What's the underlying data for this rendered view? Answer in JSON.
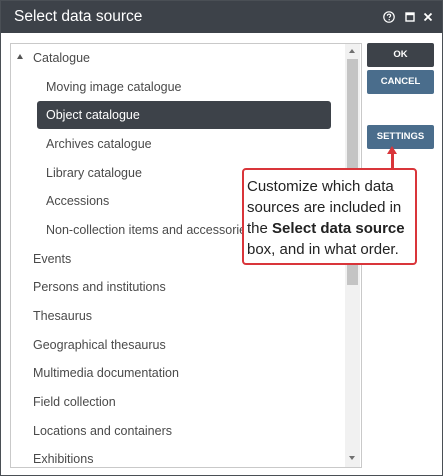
{
  "window": {
    "title": "Select data source",
    "controls": [
      "help-icon",
      "maximize-icon",
      "close-icon"
    ]
  },
  "tree": {
    "items": [
      {
        "label": "Catalogue",
        "expanded": true
      },
      {
        "label": "Moving image catalogue"
      },
      {
        "label": "Object catalogue",
        "selected": true
      },
      {
        "label": "Archives catalogue"
      },
      {
        "label": "Library catalogue"
      },
      {
        "label": "Accessions"
      },
      {
        "label": "Non-collection items and accessories"
      },
      {
        "label": "Events"
      },
      {
        "label": "Persons and institutions"
      },
      {
        "label": "Thesaurus"
      },
      {
        "label": "Geographical thesaurus"
      },
      {
        "label": "Multimedia documentation"
      },
      {
        "label": "Field collection"
      },
      {
        "label": "Locations and containers"
      },
      {
        "label": "Exhibitions"
      }
    ]
  },
  "buttons": {
    "ok": "OK",
    "cancel": "CANCEL",
    "settings": "SETTINGS"
  },
  "callout": {
    "text_before": "Customize which data sources are included in the ",
    "text_bold": "Select data source",
    "text_after": " box, and in what order."
  },
  "colors": {
    "titlebar": "#3d4249",
    "selected_row": "#3d4249",
    "primary_button": "#3d4249",
    "secondary_button": "#4a6d8c",
    "callout_border": "#d9353a"
  }
}
